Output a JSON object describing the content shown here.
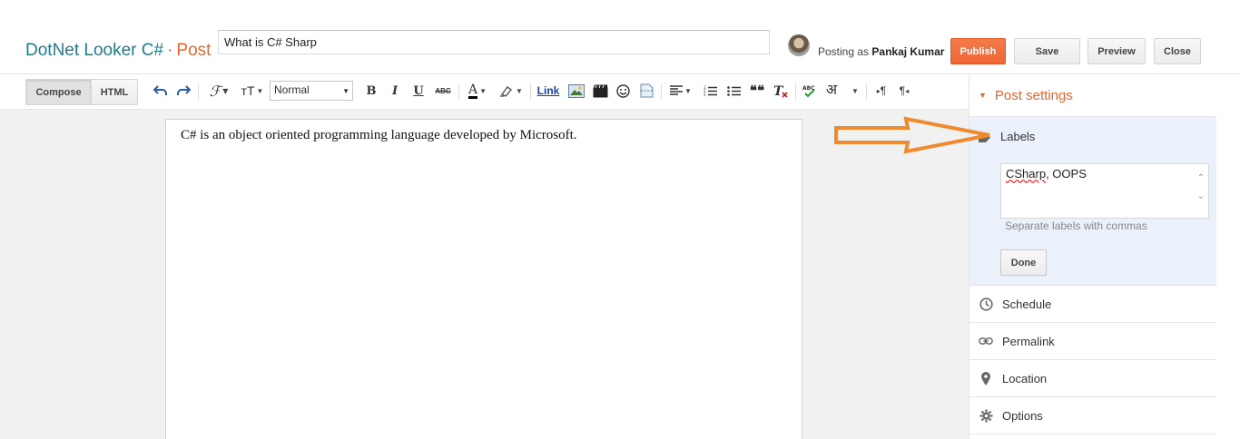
{
  "header": {
    "blog_name": "DotNet Looker C#",
    "separator": "·",
    "post_label": "Post",
    "title_value": "What is C# Sharp",
    "posting_as_prefix": "Posting as",
    "user_name": "Pankaj Kumar",
    "buttons": {
      "publish": "Publish",
      "save": "Save",
      "preview": "Preview",
      "close": "Close"
    }
  },
  "toolbar": {
    "compose": "Compose",
    "html": "HTML",
    "format_value": "Normal",
    "link": "Link",
    "icons": [
      "undo-icon",
      "redo-icon",
      "font-family-icon",
      "font-size-icon",
      "bold-icon",
      "italic-icon",
      "underline-icon",
      "strikethrough-icon",
      "text-color-icon",
      "highlight-icon",
      "link",
      "insert-image-icon",
      "insert-video-icon",
      "emoji-icon",
      "jump-break-icon",
      "align-icon",
      "numbered-list-icon",
      "bulleted-list-icon",
      "quote-icon",
      "clear-formatting-icon",
      "spellcheck-icon",
      "transliteration-icon",
      "ltr-icon",
      "rtl-icon"
    ],
    "bold_glyph": "B",
    "italic_glyph": "I",
    "underline_glyph": "U",
    "strike_glyph": "ABC",
    "text_color_glyph": "A",
    "quote_glyph": "❝❝",
    "translit_glyph": "अ",
    "font_glyph": "ℱ",
    "size_glyph": "тT",
    "ltr_glyph": "¶",
    "rtl_glyph": "¶"
  },
  "editor": {
    "content": "C# is an object oriented programming language developed by Microsoft."
  },
  "sidebar": {
    "title": "Post settings",
    "labels": {
      "heading": "Labels",
      "value_part1": "CSharp",
      "value_part2": ", OOPS",
      "hint": "Separate labels with commas",
      "done": "Done"
    },
    "items": [
      {
        "label": "Schedule",
        "icon": "clock-icon"
      },
      {
        "label": "Permalink",
        "icon": "link-icon"
      },
      {
        "label": "Location",
        "icon": "location-pin-icon"
      },
      {
        "label": "Options",
        "icon": "gear-icon"
      }
    ]
  },
  "colors": {
    "accent_orange": "#e8662d",
    "blog_title_teal": "#1e7d8c",
    "publish_bg": "#f07040",
    "labels_panel_bg": "#eaf1fb",
    "annotation_arrow": "#f08a2e"
  }
}
